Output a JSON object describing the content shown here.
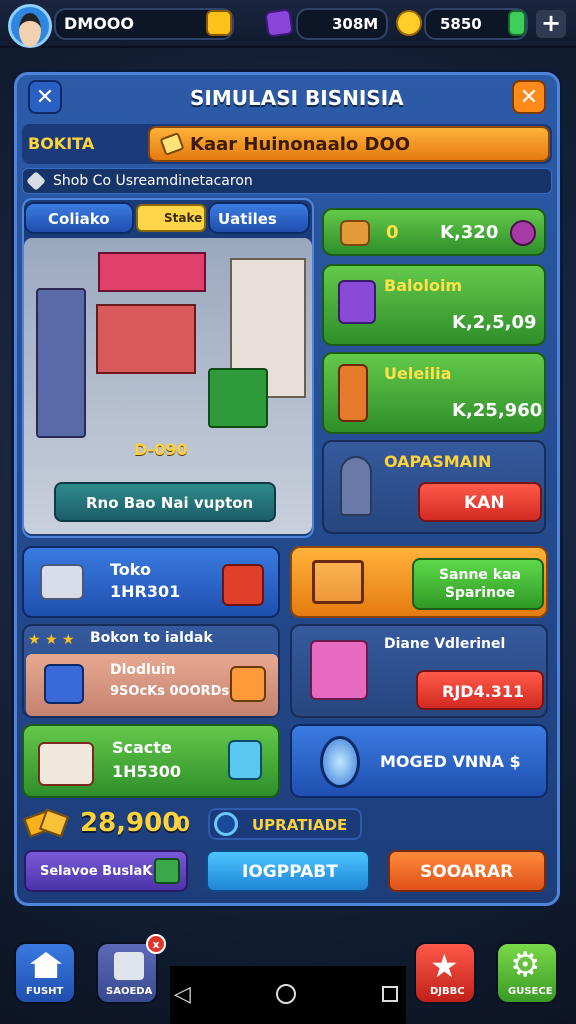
{
  "top": {
    "player_name": "DMOOO",
    "currency_1": "308M",
    "currency_2": "5850"
  },
  "panel": {
    "title": "SIMULASI BISNISIA",
    "row_label": "BOKITA",
    "row_banner": "Kaar Huinonaalo DOO",
    "info": "Shob Co Usreamdinetacaron"
  },
  "store": {
    "tab_1": "Coliako",
    "tab_badge": "Stake",
    "tab_2": "Uatiles",
    "floor_price": "D-090",
    "action_label": "Rno Bao Nai vupton"
  },
  "right_cards": {
    "box_count": "0",
    "box_value": "K,320",
    "item_1_title": "Baloloim",
    "item_1_value": "K,2,5,09",
    "item_2_title": "Ueleilia",
    "item_2_value": "K,25,960",
    "capital_title": "OAPASMAIN",
    "capital_button": "KAN"
  },
  "mid_cards": {
    "toko_name": "Toko",
    "toko_value": "1HR301",
    "cart_button": "Sanne kaa Sparinoe",
    "bonus_title": "Bokon to ialdak",
    "bonus_line1": "Dlodluin",
    "bonus_line2": "9SOcKs 0OORDs",
    "vendor_title": "Diane Vdlerinel",
    "vendor_price": "RJD4.311",
    "stock_title": "Scacte",
    "stock_value": "1H5300",
    "mirror_label": "MOGED VNNA $"
  },
  "footer": {
    "coins": "28,900",
    "coins_suffix": "0",
    "upgrade": "UPRATIADE",
    "btn_1": "Selavoe BuslaK",
    "btn_2": "IOGPPABT",
    "btn_3": "SOOARAR"
  },
  "nav": {
    "home": "FUSHT",
    "shop": "SAOEDA",
    "events": "DJBBC",
    "settings": "GUSECE",
    "shop_badge": "x"
  },
  "colors": {
    "accent_orange": "#f5a623",
    "accent_green": "#3fae34",
    "panel_blue": "#2c5ba8",
    "danger_red": "#e0352a"
  }
}
